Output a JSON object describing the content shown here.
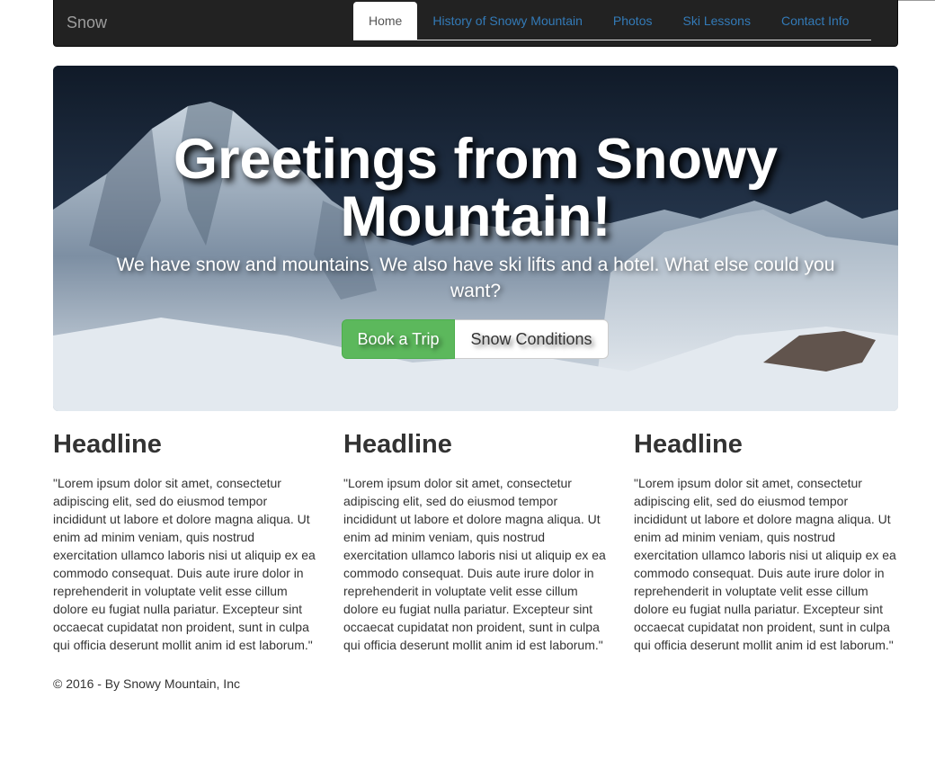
{
  "navbar": {
    "brand": "Snow",
    "items": [
      {
        "label": "Home",
        "active": true
      },
      {
        "label": "History of Snowy Mountain",
        "active": false
      },
      {
        "label": "Photos",
        "active": false
      },
      {
        "label": "Ski Lessons",
        "active": false
      },
      {
        "label": "Contact Info",
        "active": false
      }
    ]
  },
  "hero": {
    "title_line1": "Greetings from Snowy",
    "title_line2": "Mountain!",
    "subtitle": "We have snow and mountains. We also have ski lifts and a hotel. What else could you want?",
    "book_button": "Book a Trip",
    "conditions_button": "Snow Conditions"
  },
  "columns": [
    {
      "headline": "Headline",
      "body": "\"Lorem ipsum dolor sit amet, consectetur adipiscing elit, sed do eiusmod tempor incididunt ut labore et dolore magna aliqua. Ut enim ad minim veniam, quis nostrud exercitation ullamco laboris nisi ut aliquip ex ea commodo consequat. Duis aute irure dolor in reprehenderit in voluptate velit esse cillum dolore eu fugiat nulla pariatur. Excepteur sint occaecat cupidatat non proident, sunt in culpa qui officia deserunt mollit anim id est laborum.\""
    },
    {
      "headline": "Headline",
      "body": "\"Lorem ipsum dolor sit amet, consectetur adipiscing elit, sed do eiusmod tempor incididunt ut labore et dolore magna aliqua. Ut enim ad minim veniam, quis nostrud exercitation ullamco laboris nisi ut aliquip ex ea commodo consequat. Duis aute irure dolor in reprehenderit in voluptate velit esse cillum dolore eu fugiat nulla pariatur. Excepteur sint occaecat cupidatat non proident, sunt in culpa qui officia deserunt mollit anim id est laborum.\""
    },
    {
      "headline": "Headline",
      "body": "\"Lorem ipsum dolor sit amet, consectetur adipiscing elit, sed do eiusmod tempor incididunt ut labore et dolore magna aliqua. Ut enim ad minim veniam, quis nostrud exercitation ullamco laboris nisi ut aliquip ex ea commodo consequat. Duis aute irure dolor in reprehenderit in voluptate velit esse cillum dolore eu fugiat nulla pariatur. Excepteur sint occaecat cupidatat non proident, sunt in culpa qui officia deserunt mollit anim id est laborum.\""
    }
  ],
  "footer": {
    "text": "© 2016 - By Snowy Mountain, Inc"
  },
  "colors": {
    "navbar_bg": "#222222",
    "link": "#337ab7",
    "success": "#5cb85c"
  }
}
